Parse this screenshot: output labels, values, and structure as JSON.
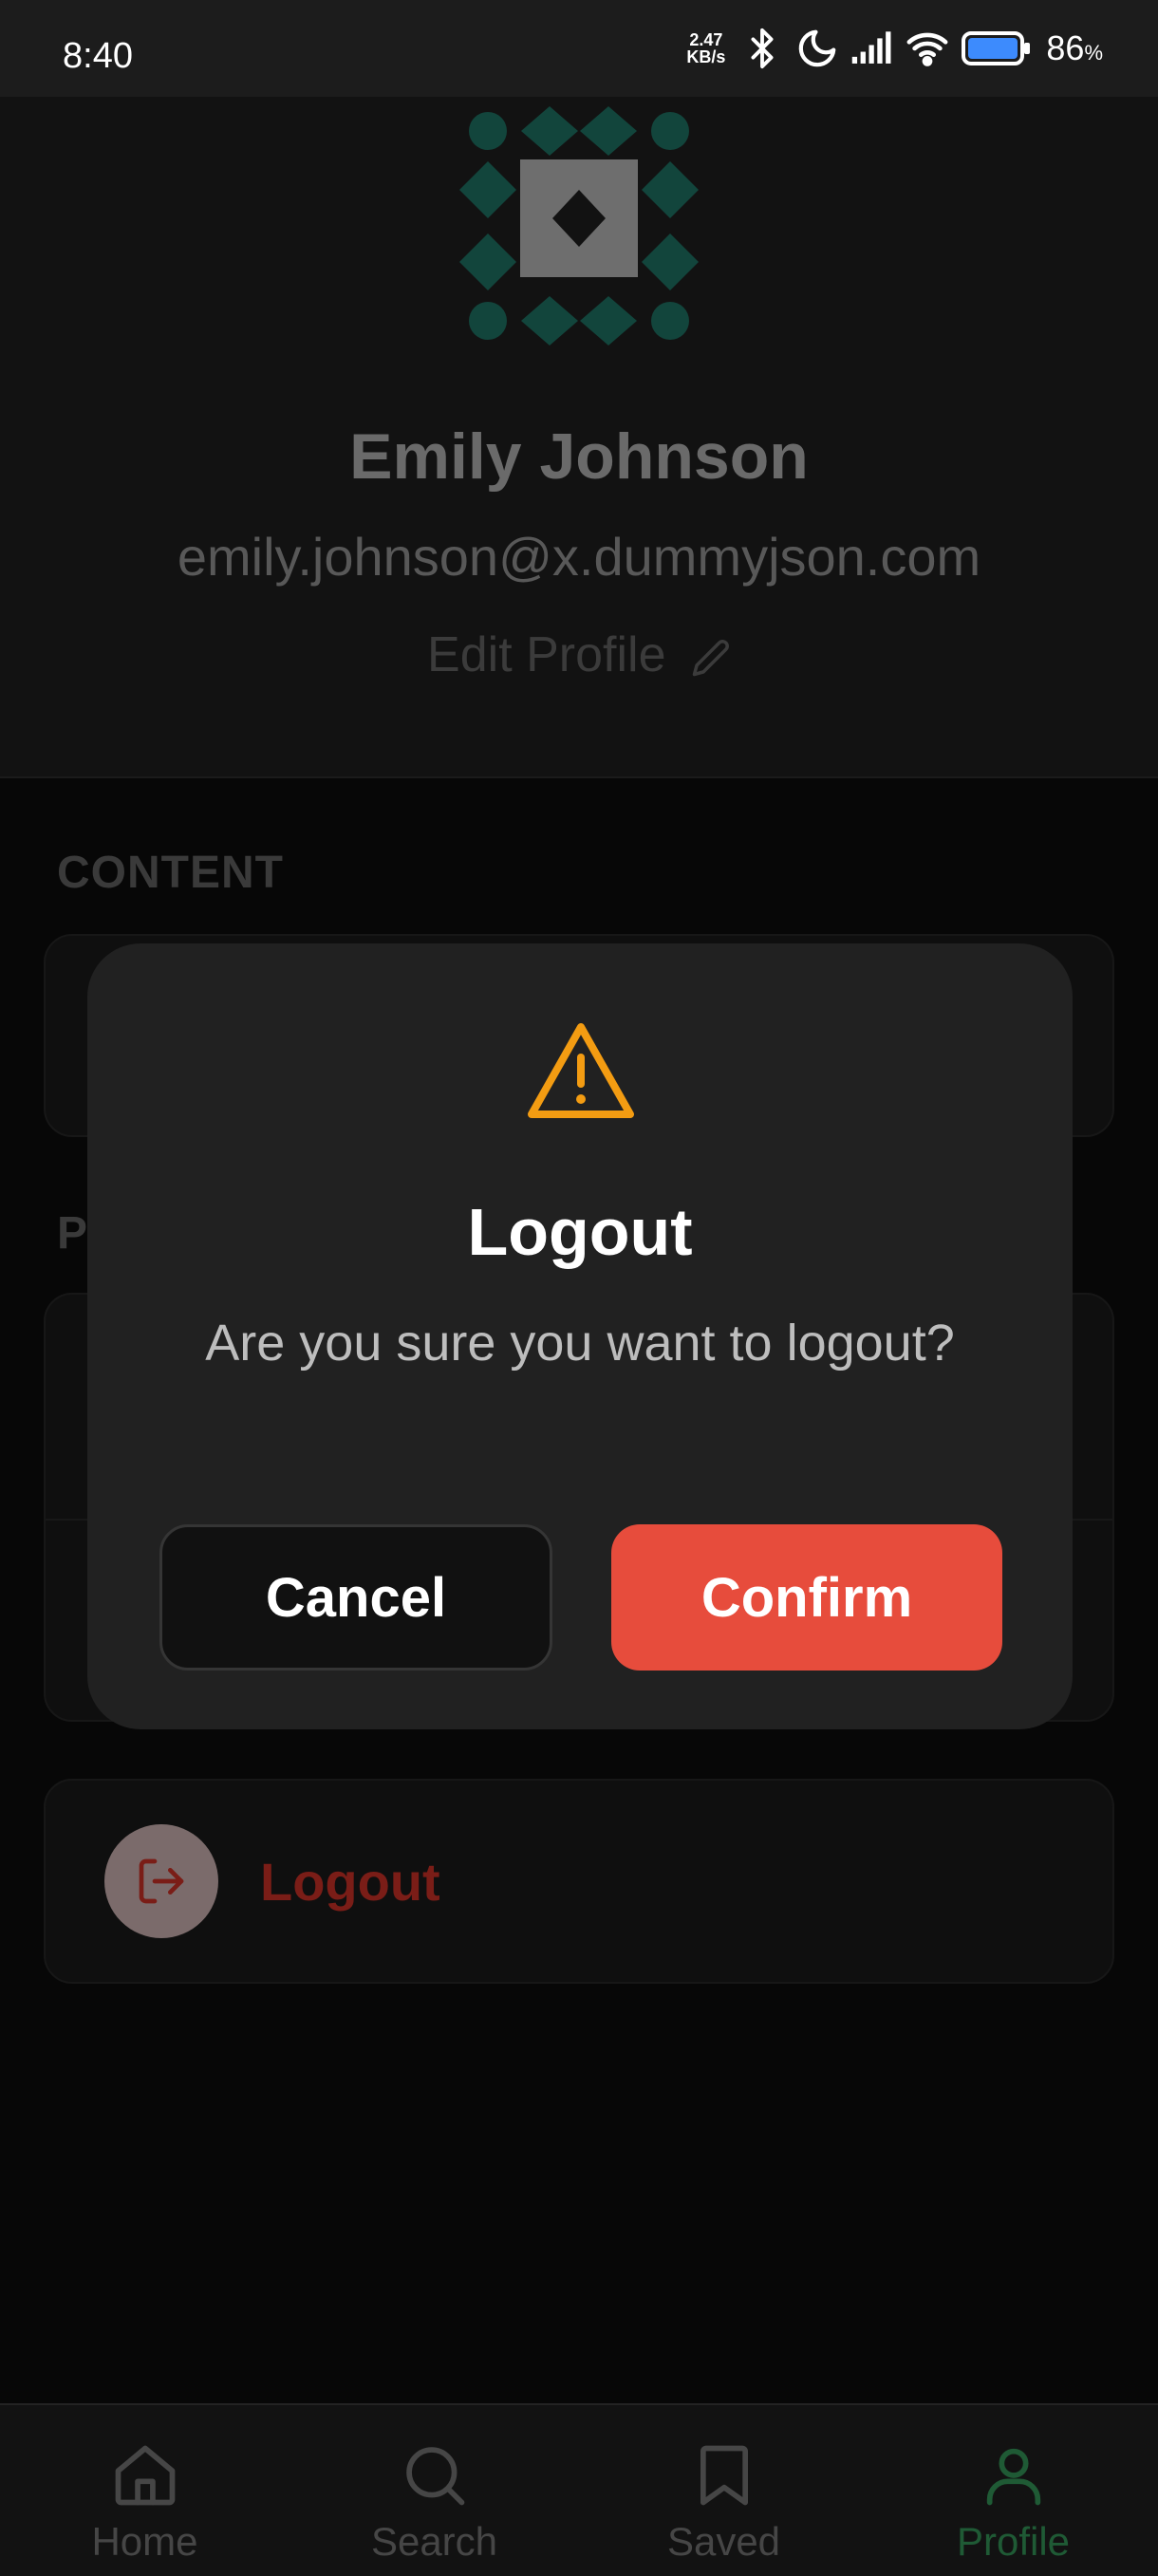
{
  "status_bar": {
    "time": "8:40",
    "net_speed_value": "2.47",
    "net_speed_unit": "KB/s",
    "battery_percent": "86",
    "battery_percent_sign": "%"
  },
  "profile": {
    "name": "Emily Johnson",
    "email": "emily.johnson@x.dummyjson.com",
    "edit_label": "Edit Profile"
  },
  "sections": {
    "content_label": "CONTENT",
    "second_label_partial": "P"
  },
  "logout_row": {
    "label": "Logout"
  },
  "dialog": {
    "title": "Logout",
    "message": "Are you sure you want to logout?",
    "cancel_label": "Cancel",
    "confirm_label": "Confirm"
  },
  "bottom_nav": {
    "items": [
      {
        "label": "Home",
        "icon": "home-icon"
      },
      {
        "label": "Search",
        "icon": "search-icon"
      },
      {
        "label": "Saved",
        "icon": "bookmark-icon"
      },
      {
        "label": "Profile",
        "icon": "profile-icon",
        "active": true
      }
    ]
  },
  "colors": {
    "accent_green": "#1f5a35",
    "danger_red": "#e74c3c",
    "warning_orange": "#f39c12"
  }
}
